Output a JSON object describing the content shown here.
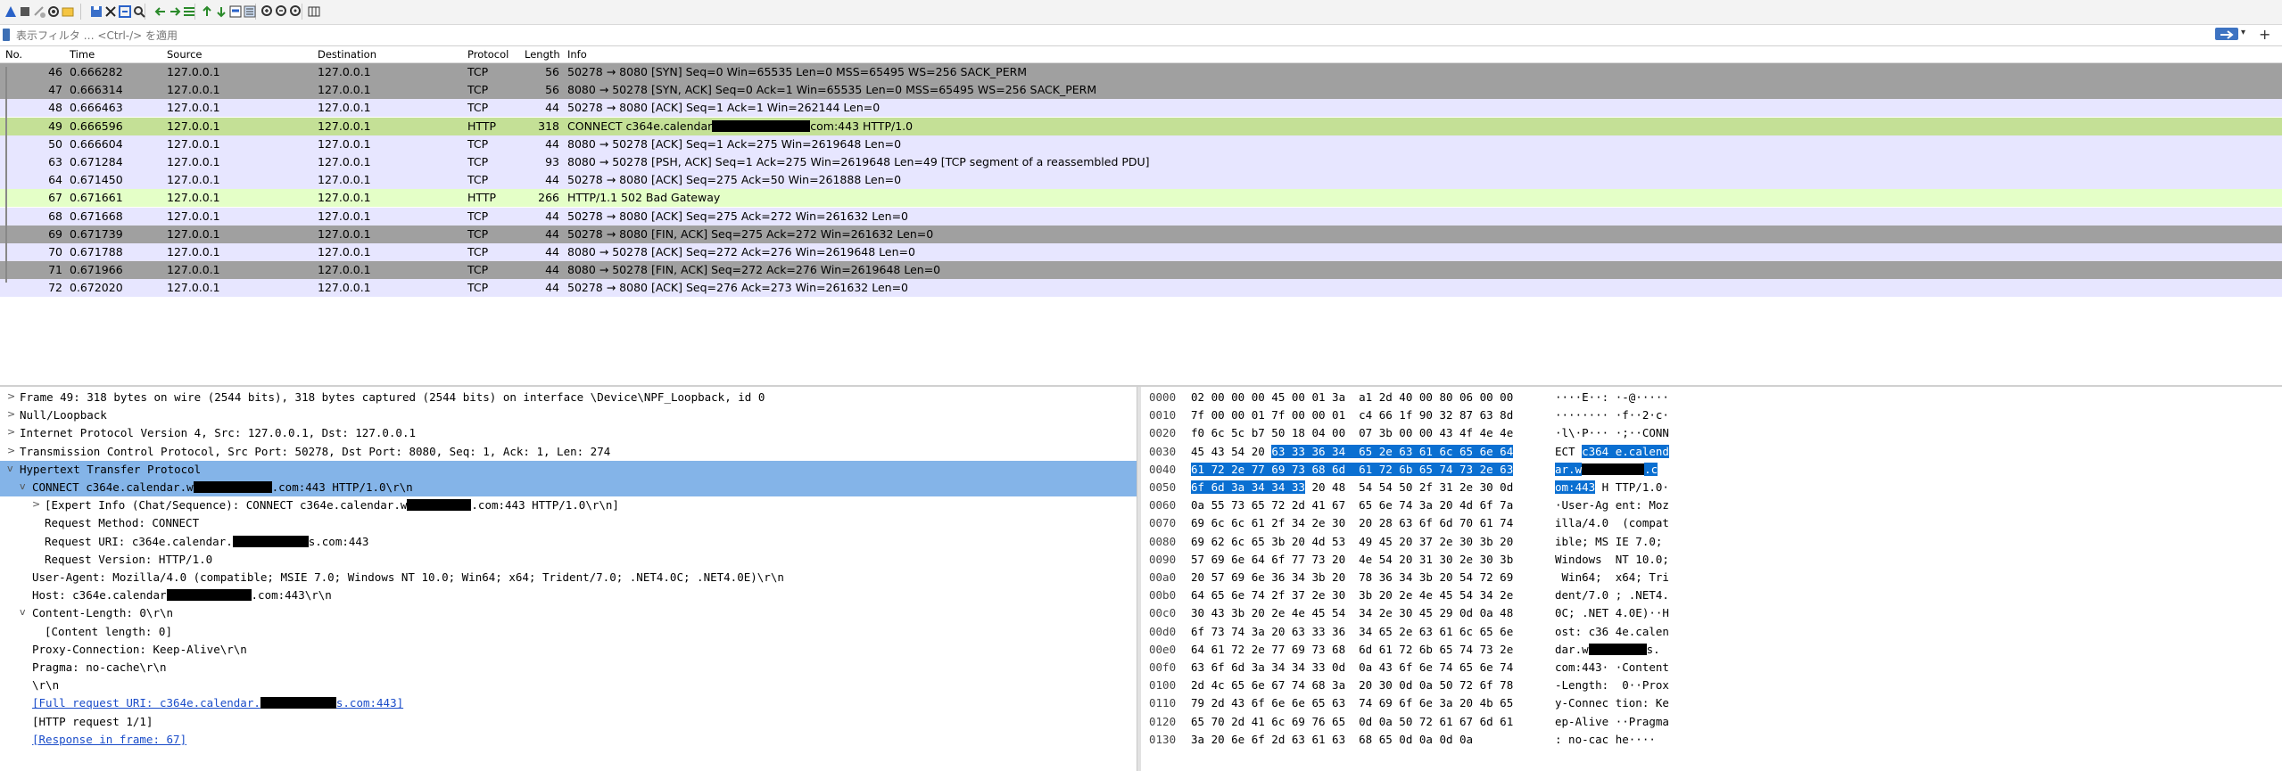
{
  "toolbar": {
    "icons": [
      "shark-start-icon",
      "stop-icon",
      "restart-icon",
      "options-gear-icon",
      "open-folder-icon",
      "save-icon",
      "close-file-icon",
      "reload-icon",
      "find-icon",
      "back-arrow-icon",
      "forward-arrow-icon",
      "goto-packet-icon",
      "first-packet-icon",
      "last-packet-icon",
      "autoscroll-icon",
      "colorize-icon",
      "zoom-in-icon",
      "zoom-out-icon",
      "zoom-reset-icon",
      "resize-columns-icon"
    ]
  },
  "filter": {
    "placeholder": "表示フィルタ … <Ctrl-/> を適用",
    "plus": "+"
  },
  "packet_list": {
    "headers": {
      "no": "No.",
      "time": "Time",
      "source": "Source",
      "destination": "Destination",
      "protocol": "Protocol",
      "length": "Length",
      "info": "Info"
    },
    "rows": [
      {
        "no": "46",
        "time": "0.666282",
        "src": "127.0.0.1",
        "dst": "127.0.0.1",
        "proto": "TCP",
        "len": "56",
        "info": "50278 → 8080 [SYN] Seq=0 Win=65535 Len=0 MSS=65495 WS=256 SACK_PERM",
        "style": "dark"
      },
      {
        "no": "47",
        "time": "0.666314",
        "src": "127.0.0.1",
        "dst": "127.0.0.1",
        "proto": "TCP",
        "len": "56",
        "info": "8080 → 50278 [SYN, ACK] Seq=0 Ack=1 Win=65535 Len=0 MSS=65495 WS=256 SACK_PERM",
        "style": "dark"
      },
      {
        "no": "48",
        "time": "0.666463",
        "src": "127.0.0.1",
        "dst": "127.0.0.1",
        "proto": "TCP",
        "len": "44",
        "info": "50278 → 8080 [ACK] Seq=1 Ack=1 Win=262144 Len=0",
        "style": "tcp"
      },
      {
        "no": "49",
        "time": "0.666596",
        "src": "127.0.0.1",
        "dst": "127.0.0.1",
        "proto": "HTTP",
        "len": "318",
        "info_pre": "CONNECT c364e.calendar",
        "info_post": "com:443 HTTP/1.0",
        "redact_w": 110,
        "style": "selected"
      },
      {
        "no": "50",
        "time": "0.666604",
        "src": "127.0.0.1",
        "dst": "127.0.0.1",
        "proto": "TCP",
        "len": "44",
        "info": "8080 → 50278 [ACK] Seq=1 Ack=275 Win=2619648 Len=0",
        "style": "tcp"
      },
      {
        "no": "63",
        "time": "0.671284",
        "src": "127.0.0.1",
        "dst": "127.0.0.1",
        "proto": "TCP",
        "len": "93",
        "info": "8080 → 50278 [PSH, ACK] Seq=1 Ack=275 Win=2619648 Len=49 [TCP segment of a reassembled PDU]",
        "style": "tcp"
      },
      {
        "no": "64",
        "time": "0.671450",
        "src": "127.0.0.1",
        "dst": "127.0.0.1",
        "proto": "TCP",
        "len": "44",
        "info": "50278 → 8080 [ACK] Seq=275 Ack=50 Win=261888 Len=0",
        "style": "tcp"
      },
      {
        "no": "67",
        "time": "0.671661",
        "src": "127.0.0.1",
        "dst": "127.0.0.1",
        "proto": "HTTP",
        "len": "266",
        "info": "HTTP/1.1 502 Bad Gateway",
        "style": "http"
      },
      {
        "no": "68",
        "time": "0.671668",
        "src": "127.0.0.1",
        "dst": "127.0.0.1",
        "proto": "TCP",
        "len": "44",
        "info": "50278 → 8080 [ACK] Seq=275 Ack=272 Win=261632 Len=0",
        "style": "tcp"
      },
      {
        "no": "69",
        "time": "0.671739",
        "src": "127.0.0.1",
        "dst": "127.0.0.1",
        "proto": "TCP",
        "len": "44",
        "info": "50278 → 8080 [FIN, ACK] Seq=275 Ack=272 Win=261632 Len=0",
        "style": "dark"
      },
      {
        "no": "70",
        "time": "0.671788",
        "src": "127.0.0.1",
        "dst": "127.0.0.1",
        "proto": "TCP",
        "len": "44",
        "info": "8080 → 50278 [ACK] Seq=272 Ack=276 Win=2619648 Len=0",
        "style": "tcp"
      },
      {
        "no": "71",
        "time": "0.671966",
        "src": "127.0.0.1",
        "dst": "127.0.0.1",
        "proto": "TCP",
        "len": "44",
        "info": "8080 → 50278 [FIN, ACK] Seq=272 Ack=276 Win=2619648 Len=0",
        "style": "dark"
      },
      {
        "no": "72",
        "time": "0.672020",
        "src": "127.0.0.1",
        "dst": "127.0.0.1",
        "proto": "TCP",
        "len": "44",
        "info": "50278 → 8080 [ACK] Seq=276 Ack=273 Win=261632 Len=0",
        "style": "tcp"
      }
    ]
  },
  "details": [
    {
      "arrow": ">",
      "pre": "Frame 49: 318 bytes on wire (2544 bits), 318 bytes captured (2544 bits) on interface \\Device\\NPF_Loopback, id 0"
    },
    {
      "arrow": ">",
      "pre": "Null/Loopback"
    },
    {
      "arrow": ">",
      "pre": "Internet Protocol Version 4, Src: 127.0.0.1, Dst: 127.0.0.1"
    },
    {
      "arrow": ">",
      "pre": "Transmission Control Protocol, Src Port: 50278, Dst Port: 8080, Seq: 1, Ack: 1, Len: 274"
    },
    {
      "arrow": "v",
      "pre": "Hypertext Transfer Protocol",
      "style": "sel"
    },
    {
      "arrow": "v",
      "pre": "CONNECT c364e.calendar.w",
      "redact_w": 88,
      "post": ".com:443 HTTP/1.0\\r\\n",
      "style": "sel"
    },
    {
      "arrow": ">",
      "pre": "[Expert Info (Chat/Sequence): CONNECT c364e.calendar.w",
      "redact_w": 72,
      "post": ".com:443 HTTP/1.0\\r\\n]"
    },
    {
      "arrow": "",
      "pre": "Request Method: CONNECT"
    },
    {
      "arrow": "",
      "pre": "Request URI: c364e.calendar.",
      "redact_w": 85,
      "post": "s.com:443"
    },
    {
      "arrow": "",
      "pre": "Request Version: HTTP/1.0"
    },
    {
      "arrow": "",
      "pre": "User-Agent: Mozilla/4.0 (compatible; MSIE 7.0; Windows NT 10.0; Win64; x64; Trident/7.0; .NET4.0C; .NET4.0E)\\r\\n"
    },
    {
      "arrow": "",
      "pre": "Host: c364e.calendar",
      "redact_w": 95,
      "post": ".com:443\\r\\n"
    },
    {
      "arrow": "v",
      "pre": "Content-Length: 0\\r\\n"
    },
    {
      "arrow": "",
      "pre": "[Content length: 0]"
    },
    {
      "arrow": "",
      "pre": "Proxy-Connection: Keep-Alive\\r\\n"
    },
    {
      "arrow": "",
      "pre": "Pragma: no-cache\\r\\n"
    },
    {
      "arrow": "",
      "pre": "\\r\\n"
    },
    {
      "arrow": "",
      "pre": "[Full request URI: c364e.calendar.",
      "redact_w": 85,
      "post": "s.com:443]",
      "style": "link"
    },
    {
      "arrow": "",
      "pre": "[HTTP request 1/1]"
    },
    {
      "arrow": "",
      "pre": "[Response in frame: 67]",
      "style": "link"
    }
  ],
  "bytes": [
    {
      "off": "0000",
      "hex": "02 00 00 00 45 00 01 3a  a1 2d 40 00 80 06 00 00",
      "asc": "····E··: ·-@·····"
    },
    {
      "off": "0010",
      "hex": "7f 00 00 01 7f 00 00 01  c4 66 1f 90 32 87 63 8d",
      "asc": "········ ·f··2·c·"
    },
    {
      "off": "0020",
      "hex": "f0 6c 5c b7 50 18 04 00  07 3b 00 00 43 4f 4e 4e",
      "asc": "·l\\·P··· ·;··CONN"
    },
    {
      "off": "0030",
      "hex": "45 43 54 20 ",
      "hex_hl": "63 33 36 34  65 2e 63 61 6c 65 6e 64",
      "asc": "ECT ",
      "asc_hl": "c364 e.calend"
    },
    {
      "off": "0040",
      "hex": "",
      "hex_hl": "61 72 2e 77 69 73 68 6d  61 72 6b 65 74 73 2e 63",
      "asc": "",
      "asc_hl": "ar.w",
      "asc_redact": 70,
      "asc_hl2": ".c"
    },
    {
      "off": "0050",
      "hex": "",
      "hex_hl": "6f 6d 3a 34 34 33",
      "hex_post": " 20 48  54 54 50 2f 31 2e 30 0d",
      "asc": "",
      "asc_hl": "om:443",
      "asc_post": " H TTP/1.0·"
    },
    {
      "off": "0060",
      "hex": "0a 55 73 65 72 2d 41 67  65 6e 74 3a 20 4d 6f 7a",
      "asc": "·User-Ag ent: Moz"
    },
    {
      "off": "0070",
      "hex": "69 6c 6c 61 2f 34 2e 30  20 28 63 6f 6d 70 61 74",
      "asc": "illa/4.0  (compat"
    },
    {
      "off": "0080",
      "hex": "69 62 6c 65 3b 20 4d 53  49 45 20 37 2e 30 3b 20",
      "asc": "ible; MS IE 7.0;"
    },
    {
      "off": "0090",
      "hex": "57 69 6e 64 6f 77 73 20  4e 54 20 31 30 2e 30 3b",
      "asc": "Windows  NT 10.0;"
    },
    {
      "off": "00a0",
      "hex": "20 57 69 6e 36 34 3b 20  78 36 34 3b 20 54 72 69",
      "asc": " Win64;  x64; Tri"
    },
    {
      "off": "00b0",
      "hex": "64 65 6e 74 2f 37 2e 30  3b 20 2e 4e 45 54 34 2e",
      "asc": "dent/7.0 ; .NET4."
    },
    {
      "off": "00c0",
      "hex": "30 43 3b 20 2e 4e 45 54  34 2e 30 45 29 0d 0a 48",
      "asc": "0C; .NET 4.0E)··H"
    },
    {
      "off": "00d0",
      "hex": "6f 73 74 3a 20 63 33 36  34 65 2e 63 61 6c 65 6e",
      "asc": "ost: c36 4e.calen"
    },
    {
      "off": "00e0",
      "hex": "64 61 72 2e 77 69 73 68  6d 61 72 6b 65 74 73 2e",
      "asc": "dar.w",
      "asc_redact": 65,
      "asc_post": "s."
    },
    {
      "off": "00f0",
      "hex": "63 6f 6d 3a 34 34 33 0d  0a 43 6f 6e 74 65 6e 74",
      "asc": "com:443· ·Content"
    },
    {
      "off": "0100",
      "hex": "2d 4c 65 6e 67 74 68 3a  20 30 0d 0a 50 72 6f 78",
      "asc": "-Length:  0··Prox"
    },
    {
      "off": "0110",
      "hex": "79 2d 43 6f 6e 6e 65 63  74 69 6f 6e 3a 20 4b 65",
      "asc": "y-Connec tion: Ke"
    },
    {
      "off": "0120",
      "hex": "65 70 2d 41 6c 69 76 65  0d 0a 50 72 61 67 6d 61",
      "asc": "ep-Alive ··Pragma"
    },
    {
      "off": "0130",
      "hex": "3a 20 6e 6f 2d 63 61 63  68 65 0d 0a 0d 0a",
      "asc": ": no-cac he····"
    }
  ],
  "colors": {
    "dark": "#a0a0a0",
    "tcp": "#e7e6ff",
    "http": "#e4ffc7",
    "selected": "#c4e096",
    "sel": "#84b4e8",
    "highlight": "#0a6fd1"
  }
}
